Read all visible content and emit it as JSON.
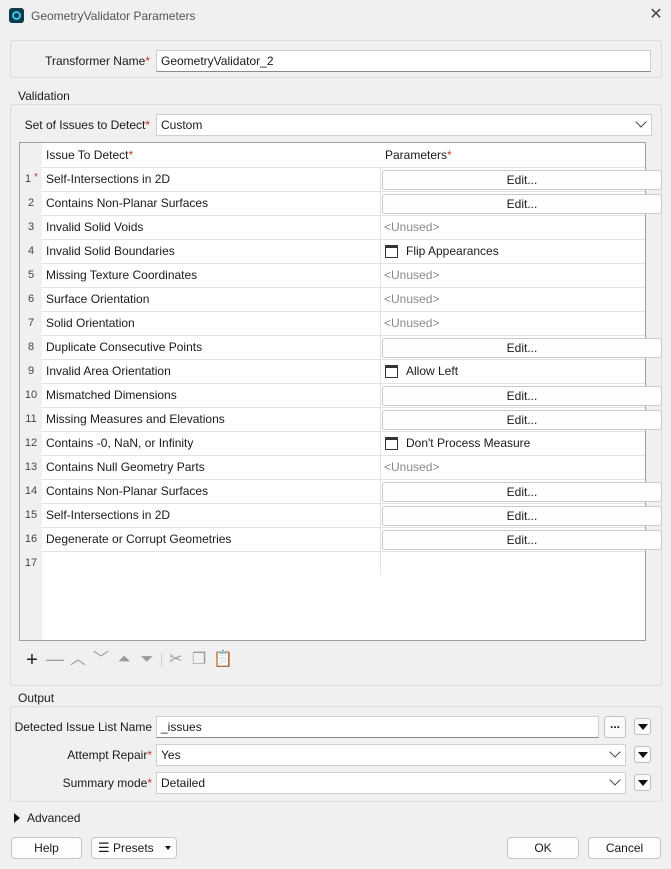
{
  "window": {
    "title": "GeometryValidator Parameters",
    "icon": "fme-transformer-icon"
  },
  "transformer": {
    "label": "Transformer Name",
    "value": "GeometryValidator_2"
  },
  "validation": {
    "group_title": "Validation",
    "issues_label": "Set of Issues to Detect",
    "issues_value": "Custom",
    "table": {
      "col_issue": "Issue To Detect",
      "col_params": "Parameters",
      "rows": [
        {
          "num": "1",
          "issue": "Self-Intersections in 2D",
          "param_type": "edit",
          "param": "Edit..."
        },
        {
          "num": "2",
          "issue": "Contains Non-Planar Surfaces",
          "param_type": "edit",
          "param": "Edit..."
        },
        {
          "num": "3",
          "issue": "Invalid Solid Voids",
          "param_type": "unused",
          "param": "<Unused>"
        },
        {
          "num": "4",
          "issue": "Invalid Solid Boundaries",
          "param_type": "check",
          "param": "Flip Appearances"
        },
        {
          "num": "5",
          "issue": "Missing Texture Coordinates",
          "param_type": "unused",
          "param": "<Unused>"
        },
        {
          "num": "6",
          "issue": "Surface Orientation",
          "param_type": "unused",
          "param": "<Unused>"
        },
        {
          "num": "7",
          "issue": "Solid Orientation",
          "param_type": "unused",
          "param": "<Unused>"
        },
        {
          "num": "8",
          "issue": "Duplicate Consecutive Points",
          "param_type": "edit",
          "param": "Edit..."
        },
        {
          "num": "9",
          "issue": "Invalid Area Orientation",
          "param_type": "check",
          "param": "Allow Left"
        },
        {
          "num": "10",
          "issue": "Mismatched Dimensions",
          "param_type": "edit",
          "param": "Edit..."
        },
        {
          "num": "11",
          "issue": "Missing Measures and Elevations",
          "param_type": "edit",
          "param": "Edit..."
        },
        {
          "num": "12",
          "issue": "Contains -0, NaN, or Infinity",
          "param_type": "check",
          "param": "Don't Process Measure"
        },
        {
          "num": "13",
          "issue": "Contains Null Geometry Parts",
          "param_type": "unused",
          "param": "<Unused>"
        },
        {
          "num": "14",
          "issue": "Contains Non-Planar Surfaces",
          "param_type": "edit",
          "param": "Edit..."
        },
        {
          "num": "15",
          "issue": "Self-Intersections in 2D",
          "param_type": "edit",
          "param": "Edit..."
        },
        {
          "num": "16",
          "issue": "Degenerate or Corrupt Geometries",
          "param_type": "edit",
          "param": "Edit..."
        },
        {
          "num": "17",
          "issue": "",
          "param_type": "empty",
          "param": ""
        }
      ]
    }
  },
  "output": {
    "group_title": "Output",
    "list_name_label": "Detected Issue List Name",
    "list_name_value": "_issues",
    "repair_label": "Attempt Repair",
    "repair_value": "Yes",
    "summary_label": "Summary mode",
    "summary_value": "Detailed",
    "ellipsis": "..."
  },
  "advanced": {
    "label": "Advanced"
  },
  "buttons": {
    "help": "Help",
    "presets": "Presets",
    "ok": "OK",
    "cancel": "Cancel"
  },
  "required_marker": "*"
}
